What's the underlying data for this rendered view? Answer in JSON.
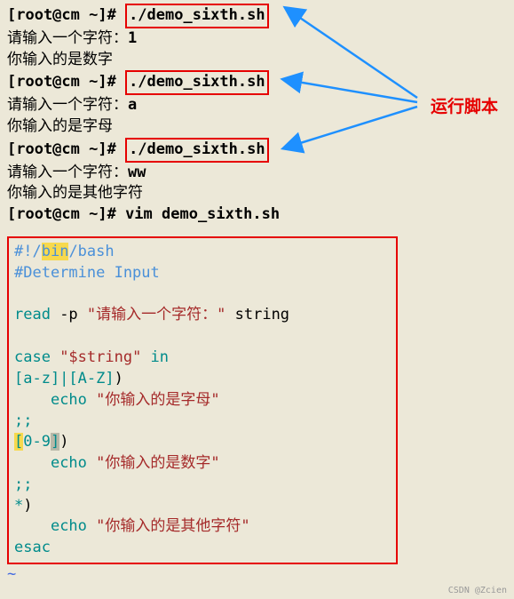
{
  "prompt": "[root@cm ~]# ",
  "runs": [
    {
      "cmd": "./demo_sixth.sh",
      "input_label": "请输入一个字符：",
      "input_val": "1",
      "output": "你输入的是数字"
    },
    {
      "cmd": "./demo_sixth.sh",
      "input_label": "请输入一个字符：",
      "input_val": "a",
      "output": "你输入的是字母"
    },
    {
      "cmd": "./demo_sixth.sh",
      "input_label": "请输入一个字符：",
      "input_val": "ww",
      "output": "你输入的是其他字符"
    }
  ],
  "vim_cmd": "vim demo_sixth.sh",
  "annotation": "运行脚本",
  "script": {
    "shebang_pre": "#!/",
    "shebang_bin": "bin",
    "shebang_post": "/bash",
    "comment": "#Determine Input",
    "read_kw": "read",
    "read_flag": " -p ",
    "read_str": "\"请输入一个字符：\"",
    "read_var": " string",
    "case_kw": "case",
    "case_var": " \"$string\" ",
    "case_in": "in",
    "pat1": "[a-z]|[A-Z]",
    "paren": ")",
    "echo": "echo",
    "msg1": "\"你输入的是字母\"",
    "sep": ";;",
    "pat2_lb": "[",
    "pat2_mid": "0-9",
    "pat2_rb": "]",
    "msg2": "\"你输入的是数字\"",
    "pat3": "*",
    "msg3": "\"你输入的是其他字符\"",
    "esac": "esac",
    "tilde": "~"
  },
  "watermark": "CSDN @Zcien"
}
